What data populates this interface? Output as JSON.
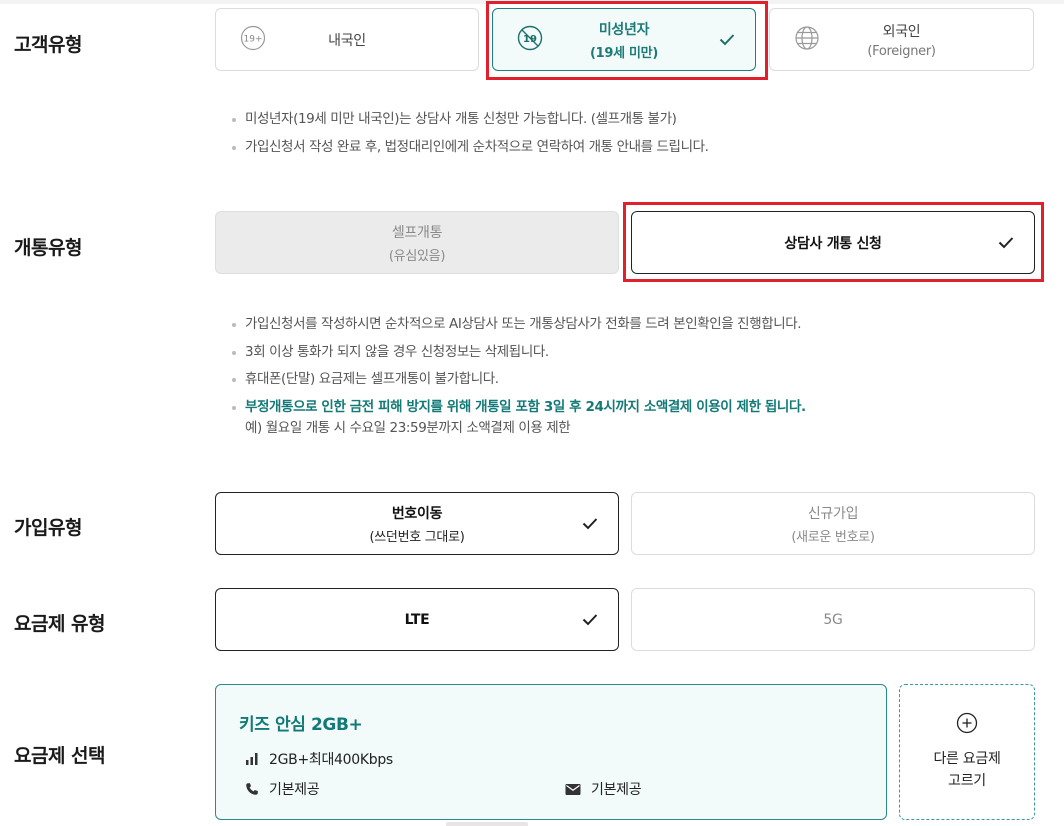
{
  "customer_type": {
    "label": "고객유형",
    "options": [
      {
        "main": "내국인",
        "sub": "",
        "icon": "age-19plus-icon",
        "selected": false
      },
      {
        "main": "미성년자",
        "sub": "(19세 미만)",
        "icon": "under-19-icon",
        "selected": true
      },
      {
        "main": "외국인",
        "sub": "(Foreigner)",
        "icon": "globe-icon",
        "selected": false
      }
    ],
    "icon_text_plus": "19+",
    "icon_text_under": "19",
    "notes": [
      "미성년자(19세 미만 내국인)는 상담사 개통 신청만 가능합니다. (셀프개통 불가)",
      "가입신청서 작성 완료 후, 법정대리인에게 순차적으로 연락하여 개통 안내를 드립니다."
    ]
  },
  "activation_type": {
    "label": "개통유형",
    "options": [
      {
        "main": "셀프개통",
        "sub": "(유심있음)",
        "selected": false,
        "disabled": true
      },
      {
        "main": "상담사 개통 신청",
        "sub": "",
        "selected": true
      }
    ],
    "notes": [
      "가입신청서를 작성하시면 순차적으로 AI상담사 또는 개통상담사가 전화를 드려 본인확인을 진행합니다.",
      "3회 이상 통화가 되지 않을 경우 신청정보는 삭제됩니다.",
      "휴대폰(단말) 요금제는 셀프개통이 불가합니다."
    ],
    "warning": "부정개통으로 인한 금전 피해 방지를 위해 개통일 포함 3일 후 24시까지 소액결제 이용이 제한 됩니다.",
    "warning_example": "예) 월요일 개통 시 수요일 23:59분까지 소액결제 이용 제한"
  },
  "join_type": {
    "label": "가입유형",
    "options": [
      {
        "main": "번호이동",
        "sub": "(쓰던번호 그대로)",
        "selected": true
      },
      {
        "main": "신규가입",
        "sub": "(새로운 번호로)",
        "selected": false
      }
    ]
  },
  "plan_type": {
    "label": "요금제 유형",
    "options": [
      {
        "main": "LTE",
        "selected": true
      },
      {
        "main": "5G",
        "selected": false
      }
    ]
  },
  "plan_select": {
    "label": "요금제 선택",
    "card": {
      "title": "키즈 안심 2GB+",
      "data": "2GB+최대400Kbps",
      "voice": "기본제공",
      "sms": "기본제공"
    },
    "other_button": "다른 요금제\n고르기"
  },
  "colors": {
    "accent_teal": "#1d7a78",
    "highlight_red": "#e2202c"
  }
}
